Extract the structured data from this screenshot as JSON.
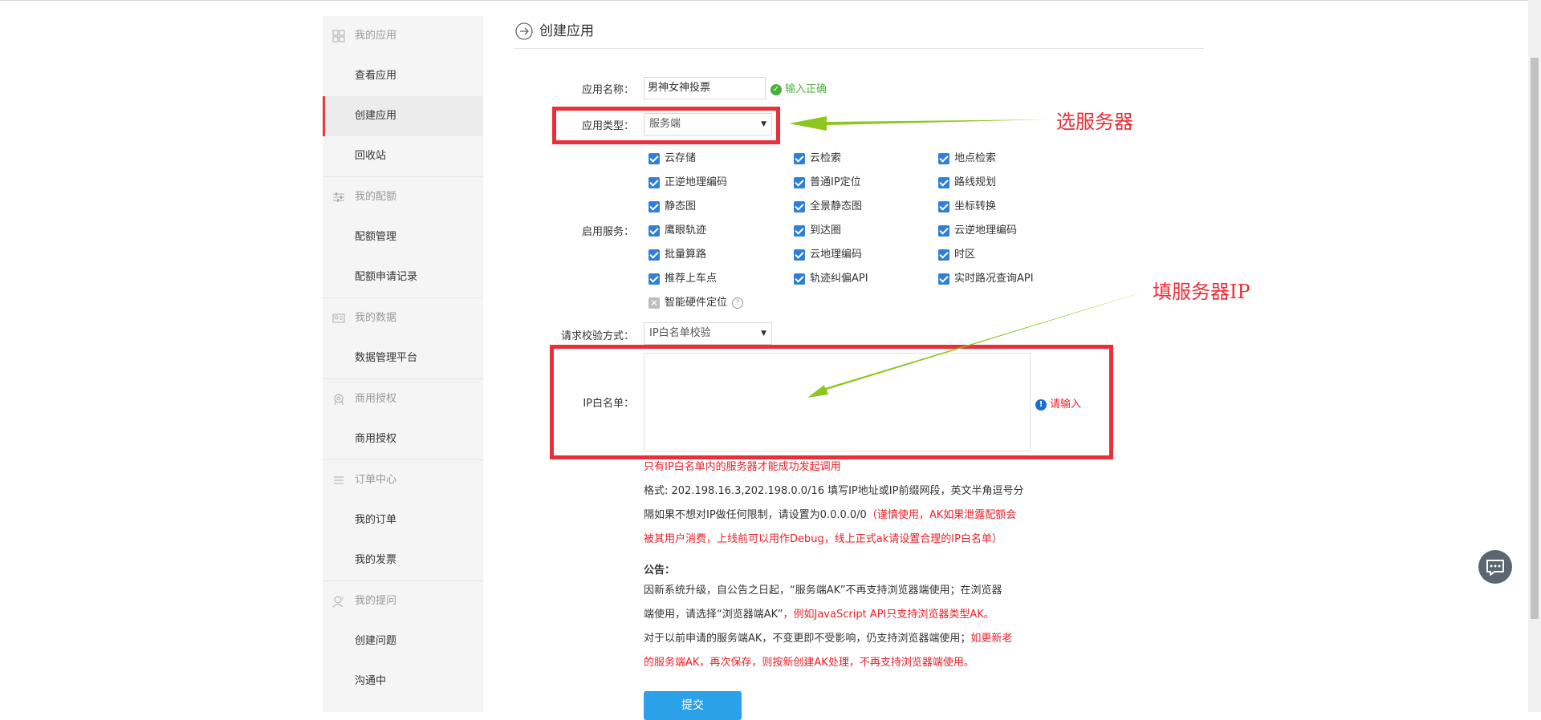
{
  "sidebar": {
    "groups": [
      {
        "label": "我的应用",
        "icon": "grid-icon"
      },
      {
        "label": "我的配额",
        "icon": "sliders-icon"
      },
      {
        "label": "我的数据",
        "icon": "id-card-icon"
      },
      {
        "label": "商用授权",
        "icon": "badge-icon"
      },
      {
        "label": "订单中心",
        "icon": "list-icon"
      },
      {
        "label": "我的提问",
        "icon": "question-user-icon"
      }
    ],
    "items": [
      {
        "label": "查看应用"
      },
      {
        "label": "创建应用"
      },
      {
        "label": "回收站"
      },
      {
        "label": "配额管理"
      },
      {
        "label": "配额申请记录"
      },
      {
        "label": "数据管理平台"
      },
      {
        "label": "商用授权"
      },
      {
        "label": "我的订单"
      },
      {
        "label": "我的发票"
      },
      {
        "label": "创建问题"
      },
      {
        "label": "沟通中"
      }
    ]
  },
  "page": {
    "title": "创建应用"
  },
  "form": {
    "app_name_label": "应用名称：",
    "app_name_value": "男神女神投票",
    "app_name_ok": "输入正确",
    "app_type_label": "应用类型：",
    "app_type_value": "服务端",
    "services_label": "启用服务：",
    "services": [
      {
        "label": "云存储",
        "checked": true
      },
      {
        "label": "云检索",
        "checked": true
      },
      {
        "label": "地点检索",
        "checked": true
      },
      {
        "label": "正逆地理编码",
        "checked": true
      },
      {
        "label": "普通IP定位",
        "checked": true
      },
      {
        "label": "路线规划",
        "checked": true
      },
      {
        "label": "静态图",
        "checked": true
      },
      {
        "label": "全景静态图",
        "checked": true
      },
      {
        "label": "坐标转换",
        "checked": true
      },
      {
        "label": "鹰眼轨迹",
        "checked": true
      },
      {
        "label": "到达圈",
        "checked": true
      },
      {
        "label": "云逆地理编码",
        "checked": true
      },
      {
        "label": "批量算路",
        "checked": true
      },
      {
        "label": "云地理编码",
        "checked": true
      },
      {
        "label": "时区",
        "checked": true
      },
      {
        "label": "推荐上车点",
        "checked": true
      },
      {
        "label": "轨迹纠偏API",
        "checked": true
      },
      {
        "label": "实时路况查询API",
        "checked": true
      },
      {
        "label": "智能硬件定位",
        "checked": false
      }
    ],
    "verify_label": "请求校验方式：",
    "verify_value": "IP白名单校验",
    "ip_label": "IP白名单：",
    "ip_warn": "请输入",
    "ip_red_note": "只有IP白名单内的服务器才能成功发起调用",
    "format_line1": "格式: 202.198.16.3,202.198.0.0/16 填写IP地址或IP前缀网段，英文半角逗号分",
    "format_line2a": "隔如果不想对IP做任何限制，请设置为0.0.0.0/0",
    "format_line2b": "（谨慎使用，AK如果泄露配额会",
    "format_line3": "被其用户消费，上线前可以用作Debug，线上正式ak请设置合理的IP白名单）",
    "notice_title": "公告：",
    "notice_line1": "因新系统升级，自公告之日起，“服务端AK”不再支持浏览器端使用；在浏览器",
    "notice_line2a": "端使用，请选择“浏览器端AK”",
    "notice_line2b": "，例如JavaScript API只支持浏览器类型AK。",
    "notice_line3a": "对于以前申请的服务端AK，不变更即不受影响，仍支持浏览器端使用；",
    "notice_line3b": "如更新老",
    "notice_line4": "的服务端AK，再次保存，则按新创建AK处理，不再支持浏览器端使用。",
    "submit_label": "提交"
  },
  "annotations": {
    "select_server": "选服务器",
    "fill_ip": "填服务器IP",
    "box_color": "#e8303a",
    "arrow_color": "#8cc61f"
  },
  "colors": {
    "accent_red": "#e83b3b",
    "checkbox_blue": "#2f7fd7",
    "submit_blue": "#2aa1e8",
    "ok_green": "#4caf3d"
  }
}
